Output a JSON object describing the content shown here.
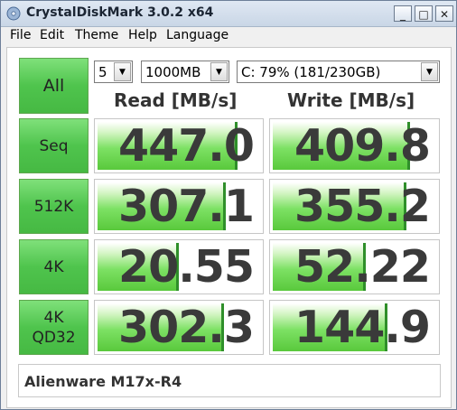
{
  "window": {
    "title": "CrystalDiskMark 3.0.2 x64"
  },
  "titlebar_buttons": {
    "minimize": "_",
    "maximize": "□",
    "close": "✕"
  },
  "menu": [
    "File",
    "Edit",
    "Theme",
    "Help",
    "Language"
  ],
  "controls": {
    "all_label": "All",
    "runs": "5",
    "size": "1000MB",
    "drive": "C: 79% (181/230GB)"
  },
  "headers": {
    "read": "Read [MB/s]",
    "write": "Write [MB/s]"
  },
  "rows": [
    {
      "label": "Seq",
      "read": "447.0",
      "write": "409.8",
      "read_fill": 0.86,
      "write_fill": 0.84
    },
    {
      "label": "512K",
      "read": "307.1",
      "write": "355.2",
      "read_fill": 0.79,
      "write_fill": 0.82
    },
    {
      "label": "4K",
      "read": "20.55",
      "write": "52.22",
      "read_fill": 0.5,
      "write_fill": 0.57
    },
    {
      "label_line1": "4K",
      "label_line2": "QD32",
      "read": "302.3",
      "write": "144.9",
      "read_fill": 0.78,
      "write_fill": 0.7
    }
  ],
  "comment": "Alienware M17x-R4",
  "colors": {
    "bar_green": "#59c93c",
    "button_green": "#4fc44d"
  }
}
